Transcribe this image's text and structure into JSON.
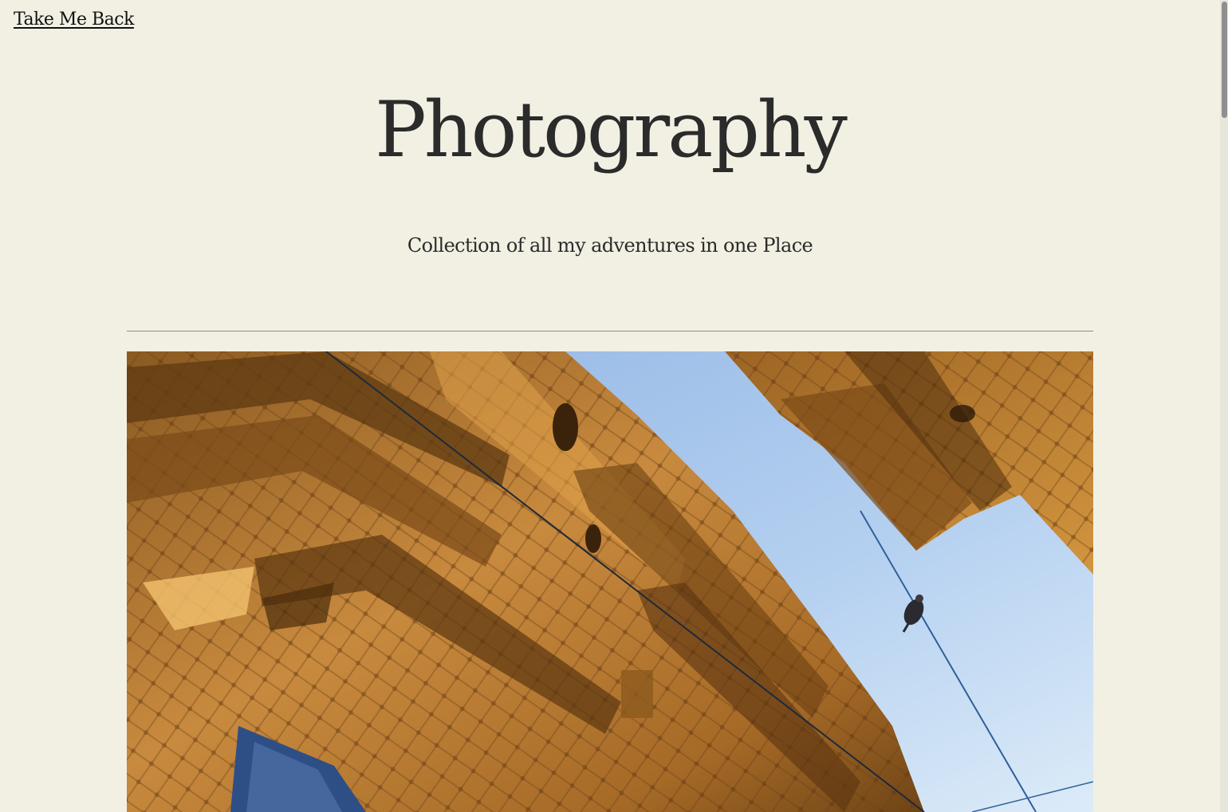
{
  "nav": {
    "back_label": "Take Me Back"
  },
  "header": {
    "title": "Photography",
    "subtitle": "Collection of all my adventures in one Place"
  },
  "gallery": {
    "photos": [
      {
        "subject": "sandstone haveli facade against blue sky with bird on wire"
      }
    ]
  },
  "colors": {
    "background": "#f2f0e3",
    "text": "#2b2b2b",
    "divider": "#8e8c86"
  }
}
